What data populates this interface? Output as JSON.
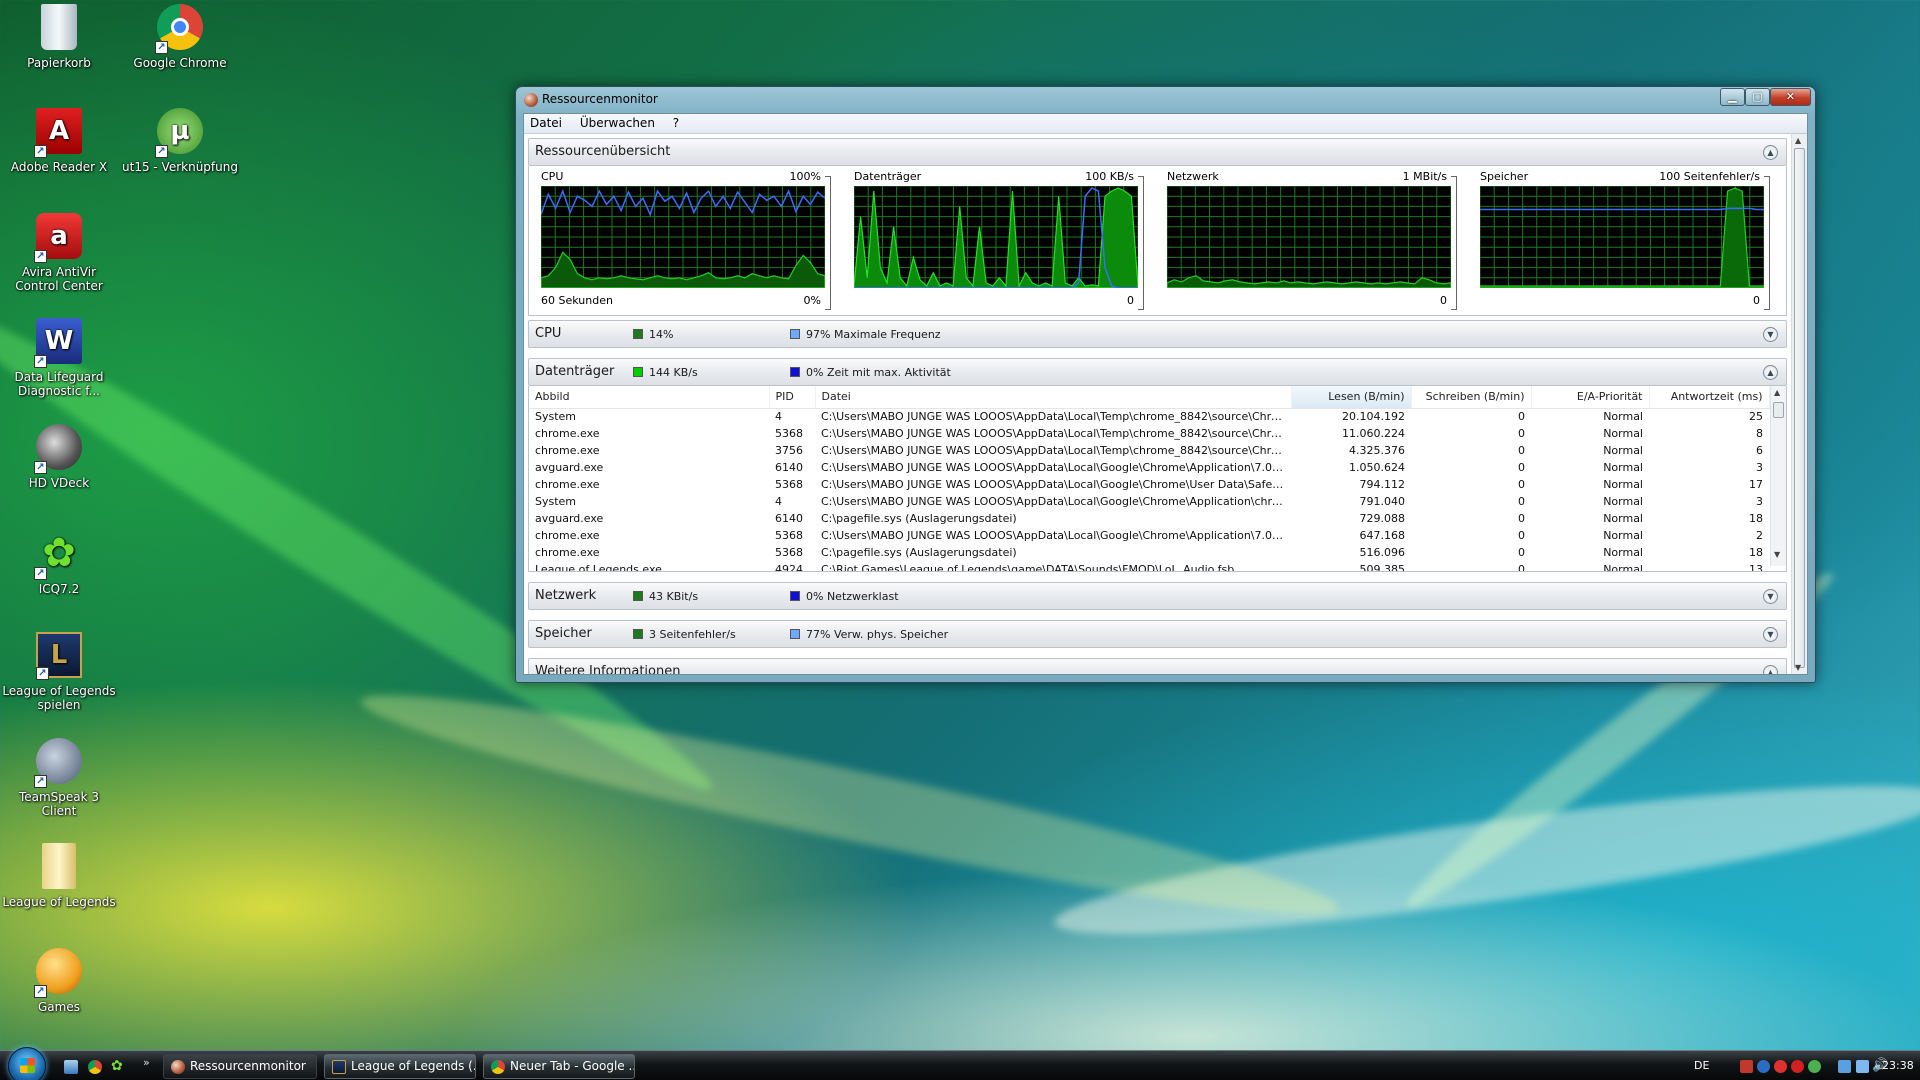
{
  "desktop": {
    "icons": [
      {
        "label": "Papierkorb",
        "name": "recycle-bin-icon"
      },
      {
        "label": "Google Chrome",
        "name": "chrome-icon"
      },
      {
        "label": "Adobe Reader X",
        "name": "adobe-reader-icon"
      },
      {
        "label": "ut15 - Verknüpfung",
        "name": "utorrent-icon"
      },
      {
        "label": "Avira AntiVir Control Center",
        "name": "avira-icon"
      },
      {
        "label": "Data Lifeguard Diagnostic f...",
        "name": "data-lifeguard-icon"
      },
      {
        "label": "HD VDeck",
        "name": "hd-vdeck-icon"
      },
      {
        "label": "ICQ7.2",
        "name": "icq-icon"
      },
      {
        "label": "League of Legends spielen",
        "name": "league-of-legends-icon"
      },
      {
        "label": "TeamSpeak 3 Client",
        "name": "teamspeak-icon"
      },
      {
        "label": "League of Legends",
        "name": "folder-icon"
      },
      {
        "label": "Games",
        "name": "games-icon"
      }
    ]
  },
  "window": {
    "title": "Ressourcenmonitor",
    "menu": [
      "Datei",
      "Überwachen",
      "?"
    ],
    "overview": {
      "title": "Ressourcenübersicht",
      "graphs": [
        {
          "title": "CPU",
          "max": "100%",
          "footer_left": "60 Sekunden",
          "footer_right": "0%"
        },
        {
          "title": "Datenträger",
          "max": "100 KB/s",
          "footer_left": "",
          "footer_right": "0"
        },
        {
          "title": "Netzwerk",
          "max": "1 MBit/s",
          "footer_left": "",
          "footer_right": "0"
        },
        {
          "title": "Speicher",
          "max": "100 Seitenfehler/s",
          "footer_left": "",
          "footer_right": "0"
        }
      ]
    },
    "cpu": {
      "title": "CPU",
      "stat1": "14%",
      "stat2": "97% Maximale Frequenz"
    },
    "disk": {
      "title": "Datenträger",
      "stat1": "144 KB/s",
      "stat2": "0% Zeit mit max. Aktivität",
      "columns": [
        "Abbild",
        "PID",
        "Datei",
        "Lesen (B/min)",
        "Schreiben (B/min)",
        "E/A-Priorität",
        "Antwortzeit (ms)"
      ],
      "rows": [
        [
          "System",
          "4",
          "C:\\Users\\MABO JUNGE WAS LOOOS\\AppData\\Local\\Temp\\chrome_8842\\source\\Chrome-...",
          "20.104.192",
          "0",
          "Normal",
          "25"
        ],
        [
          "chrome.exe",
          "5368",
          "C:\\Users\\MABO JUNGE WAS LOOOS\\AppData\\Local\\Temp\\chrome_8842\\source\\Chrome-...",
          "11.060.224",
          "0",
          "Normal",
          "8"
        ],
        [
          "chrome.exe",
          "3756",
          "C:\\Users\\MABO JUNGE WAS LOOOS\\AppData\\Local\\Temp\\chrome_8842\\source\\Chrome-...",
          "4.325.376",
          "0",
          "Normal",
          "6"
        ],
        [
          "avguard.exe",
          "6140",
          "C:\\Users\\MABO JUNGE WAS LOOOS\\AppData\\Local\\Google\\Chrome\\Application\\7.0.517....",
          "1.050.624",
          "0",
          "Normal",
          "3"
        ],
        [
          "chrome.exe",
          "5368",
          "C:\\Users\\MABO JUNGE WAS LOOOS\\AppData\\Local\\Google\\Chrome\\User Data\\Safe Bro...",
          "794.112",
          "0",
          "Normal",
          "17"
        ],
        [
          "System",
          "4",
          "C:\\Users\\MABO JUNGE WAS LOOOS\\AppData\\Local\\Google\\Chrome\\Application\\chrome...",
          "791.040",
          "0",
          "Normal",
          "3"
        ],
        [
          "avguard.exe",
          "6140",
          "C:\\pagefile.sys (Auslagerungsdatei)",
          "729.088",
          "0",
          "Normal",
          "18"
        ],
        [
          "chrome.exe",
          "5368",
          "C:\\Users\\MABO JUNGE WAS LOOOS\\AppData\\Local\\Google\\Chrome\\Application\\7.0.517....",
          "647.168",
          "0",
          "Normal",
          "2"
        ],
        [
          "chrome.exe",
          "5368",
          "C:\\pagefile.sys (Auslagerungsdatei)",
          "516.096",
          "0",
          "Normal",
          "18"
        ],
        [
          "League of Legends.exe",
          "4924",
          "C:\\Riot Games\\League of Legends\\game\\DATA\\Sounds\\FMOD\\LoL_Audio.fsb",
          "509.385",
          "0",
          "Normal",
          "13"
        ]
      ]
    },
    "network": {
      "title": "Netzwerk",
      "stat1": "43 KBit/s",
      "stat2": "0% Netzwerklast"
    },
    "memory": {
      "title": "Speicher",
      "stat1": "3 Seitenfehler/s",
      "stat2": "77% Verw. phys. Speicher"
    },
    "more": {
      "title": "Weitere Informationen"
    }
  },
  "colors": {
    "green": "#00c000",
    "dark_green": "#1c7a1c",
    "blue": "#1010d0",
    "light_blue": "#6fa8ff"
  },
  "taskbar": {
    "buttons": [
      "Ressourcenmonitor",
      "League of Legends (...",
      "Neuer Tab - Google ..."
    ],
    "lang": "DE",
    "clock": "23:38"
  }
}
